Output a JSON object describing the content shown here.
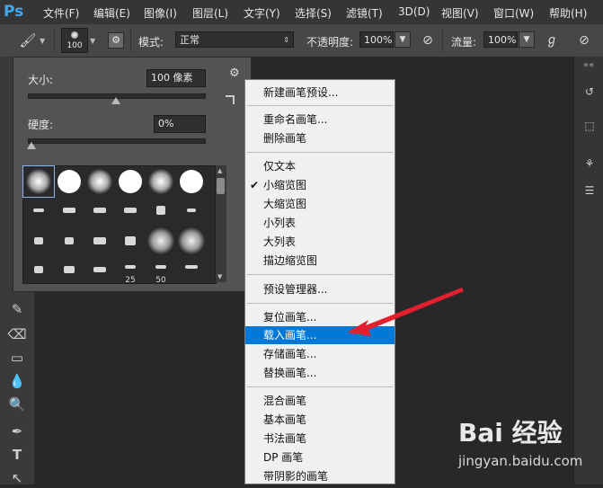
{
  "app": {
    "logo": "Ps"
  },
  "menubar": {
    "items": [
      "文件(F)",
      "编辑(E)",
      "图像(I)",
      "图层(L)",
      "文字(Y)",
      "选择(S)",
      "滤镜(T)",
      "3D(D)",
      "视图(V)",
      "窗口(W)",
      "帮助(H)"
    ]
  },
  "options": {
    "brush_size": "100",
    "mode_label": "模式:",
    "mode_value": "正常",
    "opacity_label": "不透明度:",
    "opacity_value": "100%",
    "flow_label": "流量:",
    "flow_value": "100%"
  },
  "brush_panel": {
    "size_label": "大小:",
    "size_value": "100 像素",
    "hardness_label": "硬度:",
    "hardness_value": "0%",
    "size_slider": 0.5,
    "hardness_slider": 0.0,
    "preset_numbers": [
      "25",
      "50"
    ]
  },
  "menu": {
    "items": [
      "新建画笔预设...",
      "重命名画笔...",
      "删除画笔",
      "仅文本",
      "小缩览图",
      "大缩览图",
      "小列表",
      "大列表",
      "描边缩览图",
      "预设管理器...",
      "复位画笔...",
      "载入画笔...",
      "存储画笔...",
      "替换画笔...",
      "混合画笔",
      "基本画笔",
      "书法画笔",
      "DP 画笔",
      "带阴影的画笔"
    ],
    "checked_index": 4,
    "highlighted_index": 11
  },
  "watermark": {
    "logo": "Bai 经验",
    "url": "jingyan.baidu.com"
  },
  "colors": {
    "highlight": "#0078d7",
    "arrow": "#e5202e",
    "ps_blue": "#3fa9f5"
  }
}
